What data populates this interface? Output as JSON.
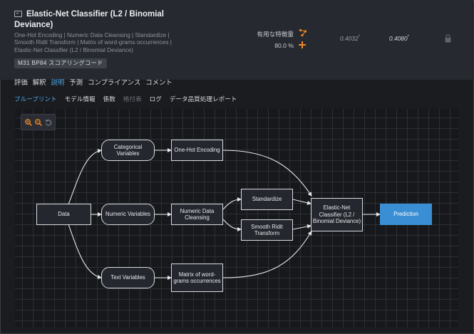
{
  "header": {
    "title": "Elastic-Net Classifier (L2 / Binomial Deviance)",
    "description": "One-Hot Encoding | Numeric Data Cleansing | Standardize | Smooth Ridit Transform | Matrix of word-grams occurrences | Elastic-Net Classifier (L2 / Binomial Deviance)",
    "badge": "M31 BP84 スコアリングコード",
    "feature_label": "有用な特徴量",
    "feature_pct": "80.0 %",
    "score_validation": "0.4032",
    "score_cv": "0.4080",
    "score_mark": "*"
  },
  "tabs": [
    {
      "label": "評価"
    },
    {
      "label": "解釈"
    },
    {
      "label": "説明",
      "active": true
    },
    {
      "label": "予測"
    },
    {
      "label": "コンプライアンス"
    },
    {
      "label": "コメント"
    }
  ],
  "subtabs": [
    {
      "label": "ブループリント",
      "active": true
    },
    {
      "label": "モデル情報"
    },
    {
      "label": "係数"
    },
    {
      "label": "格付表",
      "disabled": true
    },
    {
      "label": "ログ"
    },
    {
      "label": "データ品質処理レポート"
    }
  ],
  "blueprint": {
    "nodes": {
      "data": "Data",
      "categorical": "Categorical Variables",
      "numeric": "Numeric Variables",
      "text": "Text Variables",
      "onehot": "One-Hot Encoding",
      "cleansing": "Numeric Data Cleansing",
      "standardize": "Standardize",
      "ridit": "Smooth Ridit Transform",
      "wordgrams": "Matrix of word-grams occurrences",
      "enet": "Elastic-Net Classifier (L2 / Binomial Deviance)",
      "prediction": "Prediction"
    }
  },
  "icons": {
    "model": "model-icon",
    "feature": "feature-list-icon",
    "add": "plus-icon",
    "lock": "lock-icon",
    "zoom_in": "zoom-in-icon",
    "zoom_out": "zoom-out-icon",
    "reset": "reset-icon"
  },
  "colors": {
    "accent": "#4fa6e8",
    "orange": "#f08a24",
    "prediction": "#3a8fd4"
  }
}
